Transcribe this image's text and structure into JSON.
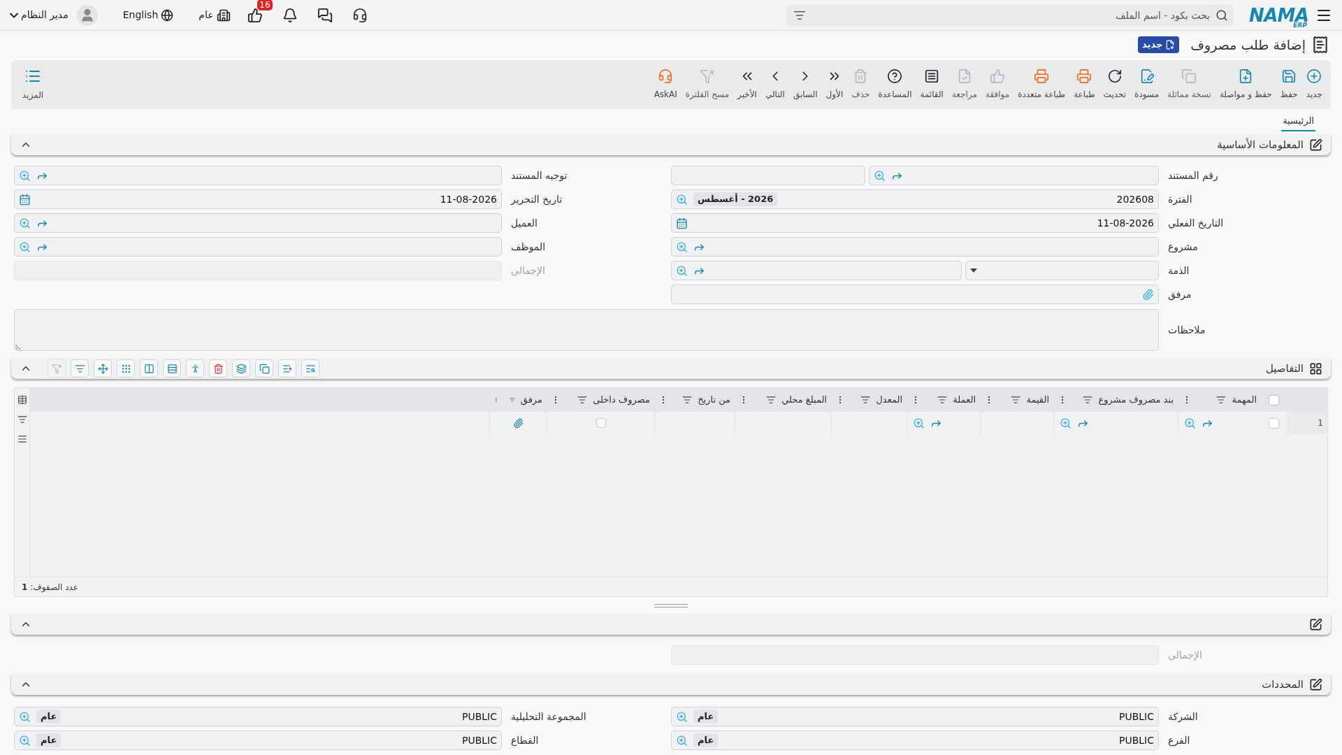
{
  "top_bar": {
    "logo": {
      "name": "NAMA",
      "suffix": "ERP"
    },
    "search": {
      "placeholder": "بحث بكود - اسم الملف"
    },
    "approvals_badge": "16",
    "branch": "عام",
    "language": "English",
    "user": "مدير النظام"
  },
  "page": {
    "title": "إضافة طلب مصروف",
    "status_badge": "جديد"
  },
  "toolbar": [
    {
      "label": "جديد",
      "disabled": false
    },
    {
      "label": "حفظ",
      "disabled": false
    },
    {
      "label": "حفظ و مواصلة",
      "disabled": false
    },
    {
      "label": "نسخة مماثلة",
      "disabled": true
    },
    {
      "label": "مسودة",
      "disabled": false
    },
    {
      "label": "تحديث",
      "disabled": false
    },
    {
      "label": "طباعة",
      "disabled": false
    },
    {
      "label": "طباعة متعددة",
      "disabled": false
    },
    {
      "label": "موافقة",
      "disabled": true
    },
    {
      "label": "مراجعة",
      "disabled": true
    },
    {
      "label": "القائمة",
      "disabled": false
    },
    {
      "label": "المساعدة",
      "disabled": false
    },
    {
      "label": "حذف",
      "disabled": true
    },
    {
      "label": "الأول",
      "disabled": false
    },
    {
      "label": "السابق",
      "disabled": false
    },
    {
      "label": "التالي",
      "disabled": false
    },
    {
      "label": "الأخير",
      "disabled": false
    },
    {
      "label": "مسح الفلترة",
      "disabled": true
    },
    {
      "label": "AskAI",
      "disabled": false
    }
  ],
  "more_button": {
    "label": "المزيد"
  },
  "tabs": [
    {
      "label": "الرئيسية",
      "selected": true
    }
  ],
  "basic_section": {
    "title": "المعلومات الأساسية",
    "expanded": true,
    "right_fields": [
      {
        "label": "رقم المستند",
        "kind": "lookup_with_box",
        "disabled": false
      },
      {
        "label": "الفترة",
        "kind": "tagged_lookup",
        "value": "202608",
        "tag": "2026 - أغسطس",
        "disabled": false
      },
      {
        "label": "التاريخ الفعلي",
        "kind": "date",
        "value": "11-08-2026",
        "disabled": false
      },
      {
        "label": "مشروع",
        "kind": "lookup",
        "disabled": false
      },
      {
        "label": "الذمة",
        "kind": "select_lookup",
        "disabled": false
      },
      {
        "label": "مرفق",
        "kind": "attachment",
        "disabled": false
      }
    ],
    "left_fields": [
      {
        "label": "توجيه المستند",
        "kind": "lookup",
        "disabled": false
      },
      {
        "label": "تاريخ التحرير",
        "kind": "date",
        "value": "11-08-2026",
        "disabled": false
      },
      {
        "label": "العميل",
        "kind": "lookup",
        "disabled": false
      },
      {
        "label": "الموظف",
        "kind": "lookup",
        "disabled": false
      },
      {
        "label": "الإجمالى",
        "kind": "readonly",
        "disabled": true
      }
    ],
    "notes": {
      "label": "ملاحظات"
    }
  },
  "details_section": {
    "title": "التفاصيل",
    "expanded": true,
    "tools": [
      {
        "disabled": false
      },
      {
        "disabled": false
      },
      {
        "disabled": false
      },
      {
        "disabled": false
      },
      {
        "disabled": false
      },
      {
        "disabled": false
      },
      {
        "disabled": false
      },
      {
        "disabled": false
      },
      {
        "disabled": false
      },
      {
        "disabled": false
      },
      {
        "disabled": false
      },
      {
        "disabled": true
      }
    ],
    "table": {
      "all_selected": false,
      "columns": [
        {
          "label": "المهمة",
          "kind": "lookup"
        },
        {
          "label": "بند مصروف مشروع",
          "kind": "lookup"
        },
        {
          "label": "القيمة",
          "kind": "text"
        },
        {
          "label": "العملة",
          "kind": "lookup"
        },
        {
          "label": "المعدل",
          "kind": "text"
        },
        {
          "label": "المبلغ محلي",
          "kind": "text"
        },
        {
          "label": "من تاريخ",
          "kind": "text"
        },
        {
          "label": "مصروف داخلى",
          "kind": "checkbox"
        },
        {
          "label": "مرفق",
          "kind": "attachment"
        }
      ],
      "rows": [
        {
          "number": "1",
          "selected": false,
          "internal_expense": false
        }
      ]
    },
    "row_count": "عدد الصفوف: **1**"
  },
  "totals_section": {
    "expanded": true,
    "fields": [
      {
        "label": "الإجمالى",
        "kind": "readonly",
        "disabled": true
      }
    ]
  },
  "dimensions_section": {
    "title": "المحددات",
    "expanded": true,
    "right_fields": [
      {
        "label": "الشركة",
        "kind": "tagged_lookup",
        "value": "PUBLIC",
        "tag": "عام",
        "disabled": false
      },
      {
        "label": "الفرع",
        "kind": "tagged_lookup",
        "value": "PUBLIC",
        "tag": "عام",
        "disabled": false
      }
    ],
    "left_fields": [
      {
        "label": "المجموعة التحليلية",
        "kind": "tagged_lookup",
        "value": "PUBLIC",
        "tag": "عام",
        "disabled": false
      },
      {
        "label": "القطاع",
        "kind": "tagged_lookup",
        "value": "PUBLIC",
        "tag": "عام",
        "disabled": false
      }
    ]
  }
}
